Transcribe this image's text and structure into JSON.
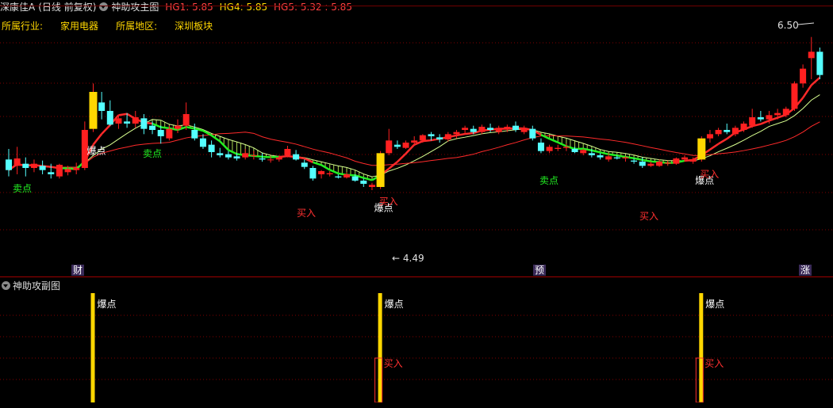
{
  "main": {
    "stock_name": "深康佳A",
    "period": "(日线 前复权)",
    "indicator": "神助攻主图",
    "hg1": "HG1: 5.85",
    "hg4": "HG4: 5.85",
    "hg5": "HG5: 5.32",
    "hg5b": ": 5.85",
    "industry_label": "所属行业:",
    "industry_value": "家用电器",
    "region_label": "所属地区:",
    "region_value": "深圳板块",
    "high_price": "6.50",
    "low_price": "4.49",
    "markers": {
      "cai": "财",
      "yu": "预",
      "zhang": "涨"
    },
    "signal_baodian": "爆点",
    "signal_buy": "买入",
    "signal_sell": "卖点"
  },
  "sub": {
    "title": "神助攻副图",
    "baodian": "爆点",
    "buy": "买入"
  },
  "colors": {
    "up": "#ff2020",
    "down": "#54ffff",
    "ma_red": "#ff2a2a",
    "green_line": "#22ee22",
    "yellow": "#ffd700",
    "grid": "#800000"
  },
  "chart_data": {
    "type": "candlestick",
    "ylim": [
      4.3,
      6.7
    ],
    "candles": [
      [
        5.34,
        5.44,
        5.18,
        5.24
      ],
      [
        5.28,
        5.46,
        5.2,
        5.35
      ],
      [
        5.3,
        5.36,
        5.18,
        5.26
      ],
      [
        5.26,
        5.34,
        5.22,
        5.3
      ],
      [
        5.28,
        5.33,
        5.2,
        5.24
      ],
      [
        5.22,
        5.3,
        5.16,
        5.2
      ],
      [
        5.18,
        5.3,
        5.16,
        5.29
      ],
      [
        5.22,
        5.28,
        5.19,
        5.25
      ],
      [
        5.24,
        5.31,
        5.2,
        5.26
      ],
      [
        5.26,
        5.7,
        5.24,
        5.62
      ],
      [
        5.63,
        6.06,
        5.6,
        5.98
      ],
      [
        5.88,
        5.98,
        5.72,
        5.8
      ],
      [
        5.8,
        5.9,
        5.66,
        5.67
      ],
      [
        5.68,
        5.76,
        5.63,
        5.73
      ],
      [
        5.7,
        5.78,
        5.64,
        5.68
      ],
      [
        5.68,
        5.8,
        5.64,
        5.74
      ],
      [
        5.73,
        5.77,
        5.58,
        5.63
      ],
      [
        5.66,
        5.7,
        5.58,
        5.62
      ],
      [
        5.62,
        5.66,
        5.49,
        5.56
      ],
      [
        5.54,
        5.66,
        5.52,
        5.63
      ],
      [
        5.63,
        5.72,
        5.59,
        5.66
      ],
      [
        5.66,
        5.88,
        5.62,
        5.77
      ],
      [
        5.62,
        5.68,
        5.52,
        5.54
      ],
      [
        5.54,
        5.58,
        5.44,
        5.46
      ],
      [
        5.48,
        5.52,
        5.36,
        5.41
      ],
      [
        5.4,
        5.45,
        5.36,
        5.38
      ],
      [
        5.39,
        5.42,
        5.34,
        5.36
      ],
      [
        5.37,
        5.4,
        5.33,
        5.35
      ],
      [
        5.36,
        5.44,
        5.34,
        5.4
      ],
      [
        5.38,
        5.42,
        5.34,
        5.38
      ],
      [
        5.35,
        5.4,
        5.32,
        5.34
      ],
      [
        5.34,
        5.37,
        5.31,
        5.34
      ],
      [
        5.34,
        5.38,
        5.32,
        5.36
      ],
      [
        5.38,
        5.47,
        5.36,
        5.44
      ],
      [
        5.39,
        5.43,
        5.33,
        5.34
      ],
      [
        5.31,
        5.34,
        5.25,
        5.27
      ],
      [
        5.26,
        5.28,
        5.14,
        5.16
      ],
      [
        5.2,
        5.24,
        5.16,
        5.23
      ],
      [
        5.2,
        5.23,
        5.18,
        5.21
      ],
      [
        5.18,
        5.2,
        5.16,
        5.17
      ],
      [
        5.17,
        5.22,
        5.16,
        5.2
      ],
      [
        5.18,
        5.2,
        5.13,
        5.14
      ],
      [
        5.14,
        5.16,
        5.08,
        5.11
      ],
      [
        5.08,
        5.12,
        5.05,
        5.1
      ],
      [
        5.08,
        5.42,
        5.06,
        5.4
      ],
      [
        5.4,
        5.63,
        5.38,
        5.52
      ],
      [
        5.48,
        5.52,
        5.44,
        5.46
      ],
      [
        5.45,
        5.52,
        5.44,
        5.5
      ],
      [
        5.5,
        5.56,
        5.48,
        5.52
      ],
      [
        5.52,
        5.58,
        5.5,
        5.57
      ],
      [
        5.58,
        5.6,
        5.52,
        5.56
      ],
      [
        5.55,
        5.58,
        5.5,
        5.53
      ],
      [
        5.53,
        5.6,
        5.51,
        5.58
      ],
      [
        5.58,
        5.62,
        5.54,
        5.6
      ],
      [
        5.62,
        5.66,
        5.58,
        5.64
      ],
      [
        5.63,
        5.66,
        5.58,
        5.6
      ],
      [
        5.6,
        5.67,
        5.58,
        5.65
      ],
      [
        5.64,
        5.68,
        5.6,
        5.62
      ],
      [
        5.6,
        5.66,
        5.58,
        5.64
      ],
      [
        5.63,
        5.67,
        5.6,
        5.65
      ],
      [
        5.66,
        5.7,
        5.6,
        5.62
      ],
      [
        5.6,
        5.66,
        5.58,
        5.64
      ],
      [
        5.63,
        5.66,
        5.52,
        5.54
      ],
      [
        5.5,
        5.54,
        5.4,
        5.42
      ],
      [
        5.42,
        5.48,
        5.4,
        5.46
      ],
      [
        5.44,
        5.48,
        5.42,
        5.45
      ],
      [
        5.45,
        5.49,
        5.42,
        5.46
      ],
      [
        5.44,
        5.46,
        5.4,
        5.41
      ],
      [
        5.4,
        5.44,
        5.38,
        5.43
      ],
      [
        5.4,
        5.44,
        5.36,
        5.38
      ],
      [
        5.38,
        5.4,
        5.34,
        5.36
      ],
      [
        5.34,
        5.4,
        5.32,
        5.37
      ],
      [
        5.36,
        5.38,
        5.34,
        5.35
      ],
      [
        5.35,
        5.37,
        5.32,
        5.36
      ],
      [
        5.33,
        5.35,
        5.3,
        5.32
      ],
      [
        5.32,
        5.36,
        5.26,
        5.28
      ],
      [
        5.28,
        5.32,
        5.27,
        5.3
      ],
      [
        5.28,
        5.34,
        5.27,
        5.32
      ],
      [
        5.3,
        5.33,
        5.28,
        5.31
      ],
      [
        5.3,
        5.36,
        5.29,
        5.35
      ],
      [
        5.34,
        5.38,
        5.32,
        5.36
      ],
      [
        5.32,
        5.36,
        5.3,
        5.34
      ],
      [
        5.34,
        5.56,
        5.32,
        5.54
      ],
      [
        5.54,
        5.62,
        5.5,
        5.58
      ],
      [
        5.58,
        5.64,
        5.56,
        5.62
      ],
      [
        5.62,
        5.68,
        5.58,
        5.6
      ],
      [
        5.58,
        5.66,
        5.56,
        5.64
      ],
      [
        5.62,
        5.7,
        5.6,
        5.68
      ],
      [
        5.66,
        5.82,
        5.64,
        5.74
      ],
      [
        5.74,
        5.8,
        5.7,
        5.72
      ],
      [
        5.72,
        5.8,
        5.68,
        5.76
      ],
      [
        5.76,
        5.82,
        5.72,
        5.78
      ],
      [
        5.76,
        5.84,
        5.74,
        5.82
      ],
      [
        5.82,
        6.08,
        5.8,
        6.06
      ],
      [
        6.06,
        6.24,
        6.02,
        6.2
      ],
      [
        6.3,
        6.5,
        6.1,
        6.36
      ],
      [
        6.36,
        6.4,
        6.1,
        6.14
      ]
    ],
    "baodian_index": [
      10,
      44,
      82
    ],
    "buy_index": [
      44,
      82
    ]
  }
}
